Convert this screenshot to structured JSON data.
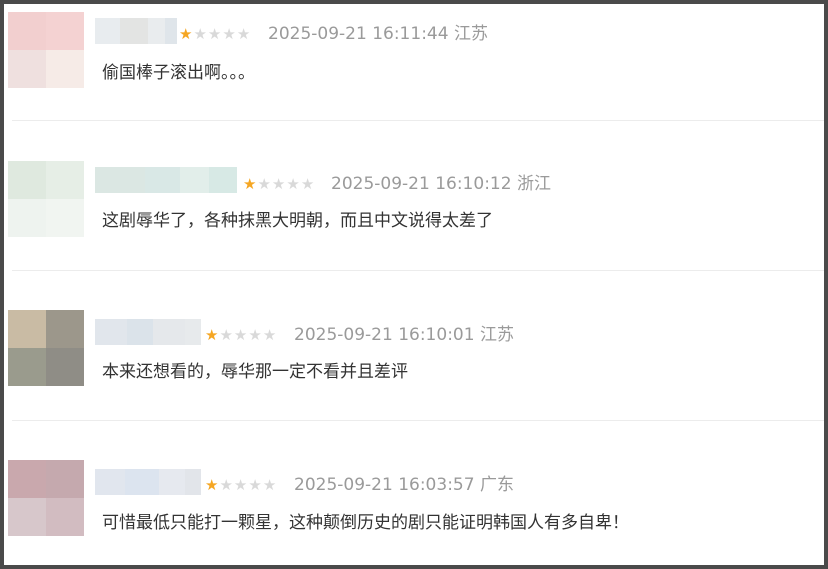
{
  "colors": {
    "star_filled": "#f5a623",
    "star_empty": "#d9d9d9",
    "meta_text": "#9a9a9a",
    "content_text": "#333333",
    "frame_border": "#4a4a4a"
  },
  "rating_display": {
    "filled_char": "★",
    "empty_char": "★",
    "max_stars": 5
  },
  "reviews": [
    {
      "rating": 1,
      "timestamp": "2025-09-21 16:11:44",
      "location": "江苏",
      "content": "偷国棒子滚出啊。。。",
      "avatar_colors": [
        "#f2cfcf",
        "#f4d2d2",
        "#efe0df",
        "#f6ebe7"
      ],
      "username_colors": [
        "#e8ecef",
        "#e3e4e3",
        "#e9ecee",
        "#dfe5ea"
      ]
    },
    {
      "rating": 1,
      "timestamp": "2025-09-21 16:10:12",
      "location": "浙江",
      "content": "这剧辱华了，各种抹黑大明朝，而且中文说得太差了",
      "avatar_colors": [
        "#dfe9df",
        "#e6eee6",
        "#eef3ef",
        "#f1f5f1"
      ],
      "username_colors": [
        "#dbe7e3",
        "#d9e8e6",
        "#e2eeea",
        "#d7e9e5"
      ]
    },
    {
      "rating": 1,
      "timestamp": "2025-09-21 16:10:01",
      "location": "江苏",
      "content": "本来还想看的，辱华那一定不看并且差评",
      "avatar_colors": [
        "#c9bba4",
        "#9c978b",
        "#9a9b8d",
        "#8f8d86"
      ],
      "username_colors": [
        "#e1e6ec",
        "#dbe3ea",
        "#e5e8eb",
        "#e7eaec"
      ]
    },
    {
      "rating": 1,
      "timestamp": "2025-09-21 16:03:57",
      "location": "广东",
      "content": "可惜最低只能打一颗星，这种颠倒历史的剧只能证明韩国人有多自卑！",
      "avatar_colors": [
        "#c9a8ad",
        "#c5a9ae",
        "#d7c7cb",
        "#d2bcc1"
      ],
      "username_colors": [
        "#e1e6ee",
        "#dce4ef",
        "#e6e9ef",
        "#e2e5ea"
      ]
    }
  ]
}
